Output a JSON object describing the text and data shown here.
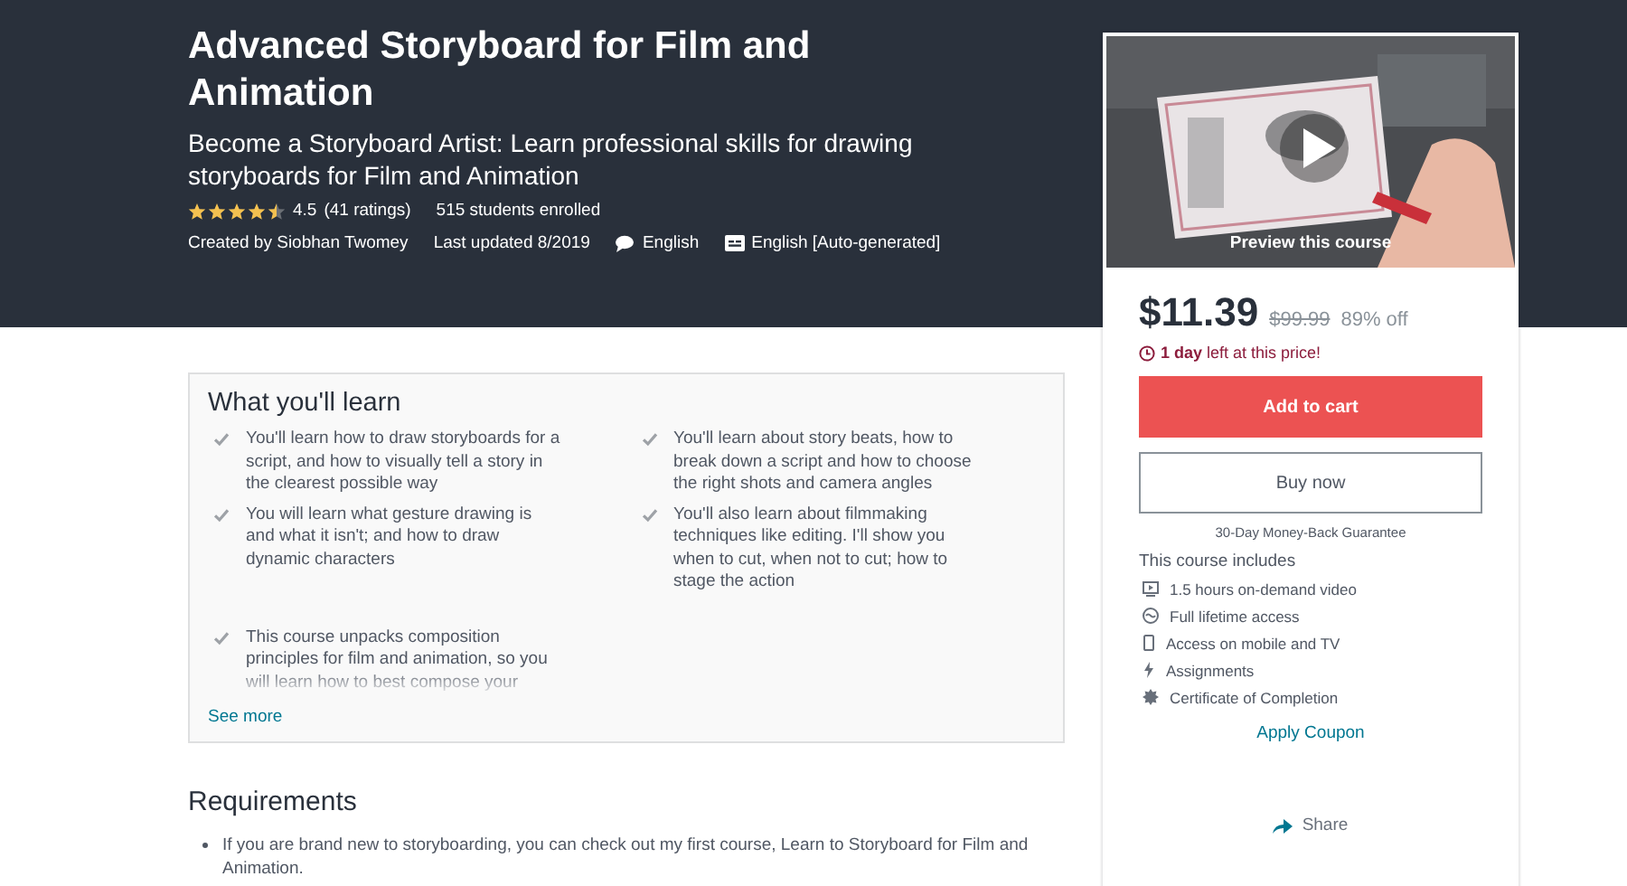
{
  "course": {
    "title": "Advanced Storyboard for Film and Animation",
    "subtitle": "Become a Storyboard Artist: Learn professional skills for drawing storyboards for Film and Animation",
    "stars": 4.5,
    "rating": "4.5",
    "ratings_count": "(41 ratings)",
    "enrolled": "515 students enrolled",
    "created_by": "Created by Siobhan Twomey",
    "last_updated": "Last updated 8/2019",
    "language": "English",
    "captions": "English [Auto-generated]"
  },
  "learn": {
    "title": "What you'll learn",
    "items": [
      {
        "text": "You'll learn how to draw storyboards for a script, and how to visually tell a story in the clearest possible way"
      },
      {
        "text": "You'll learn about story beats, how to break down a script and how to choose the right shots and camera angles"
      },
      {
        "text": "You will learn what gesture drawing is and what it isn't; and how to draw dynamic characters"
      },
      {
        "text": "You'll also learn about filmmaking techniques like editing. I'll show you when to cut, when not to cut; how to stage the action"
      },
      {
        "text": "This course unpacks composition principles for film and animation, so you will learn how to best compose your"
      }
    ],
    "see_more": "See more"
  },
  "requirements": {
    "title": "Requirements",
    "items": [
      "If you are brand new to storyboarding, you can check out my first course, Learn to Storyboard for Film and Animation."
    ]
  },
  "sidebar": {
    "preview": {
      "kind": "picture",
      "label": "Preview this course"
    },
    "price": "$11.39",
    "original_price": "$99.99",
    "discount": "89% off",
    "timer_bold": "1 day",
    "timer_rest": "left at this price!",
    "add_to_cart": "Add to cart",
    "buy_now": "Buy now",
    "guarantee": "30-Day Money-Back Guarantee",
    "includes_title": "This course includes",
    "includes": [
      {
        "kind": "video",
        "text": "1.5 hours on-demand video"
      },
      {
        "kind": "lifetime",
        "text": "Full lifetime access"
      },
      {
        "kind": "mobile",
        "text": "Access on mobile and TV"
      },
      {
        "kind": "assignment",
        "text": "Assignments"
      },
      {
        "kind": "certificate",
        "text": "Certificate of Completion"
      }
    ],
    "coupon": "Apply Coupon",
    "share": "Share"
  }
}
